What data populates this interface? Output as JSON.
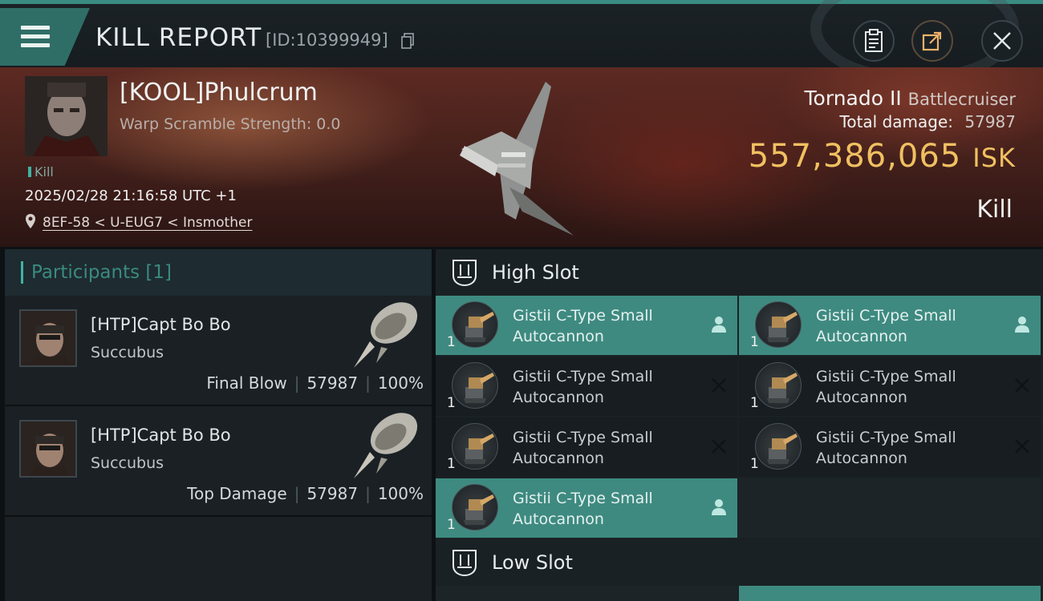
{
  "header": {
    "title": "KILL REPORT",
    "report_id": "[ID:10399949]",
    "icons": [
      "menu-icon",
      "copy-icon",
      "clipboard-icon",
      "share-icon",
      "close-icon"
    ]
  },
  "victim": {
    "name": "[KOOL]Phulcrum",
    "scramble": "Warp Scramble Strength: 0.0",
    "tag": "Kill",
    "timestamp": "2025/02/28 21:16:58 UTC +1",
    "location": "8EF-58 < U-EUG7 < Insmother",
    "ship": "Tornado II",
    "ship_class": "Battlecruiser",
    "total_damage_label": "Total damage:",
    "total_damage": "57987",
    "isk": "557,386,065",
    "isk_unit": "ISK",
    "result": "Kill"
  },
  "participants": {
    "header": "Participants [1]",
    "rows": [
      {
        "name": "[HTP]Capt Bo Bo",
        "ship": "Succubus",
        "role": "Final Blow",
        "damage": "57987",
        "percent": "100%"
      },
      {
        "name": "[HTP]Capt Bo Bo",
        "ship": "Succubus",
        "role": "Top Damage",
        "damage": "57987",
        "percent": "100%"
      }
    ]
  },
  "high_slot": {
    "title": "High Slot",
    "items": [
      {
        "line1": "Gistii C-Type Small",
        "line2": "Autocannon",
        "qty": "1",
        "state": "dropped"
      },
      {
        "line1": "Gistii C-Type Small",
        "line2": "Autocannon",
        "qty": "1",
        "state": "dropped"
      },
      {
        "line1": "Gistii C-Type Small",
        "line2": "Autocannon",
        "qty": "1",
        "state": "destroyed"
      },
      {
        "line1": "Gistii C-Type Small",
        "line2": "Autocannon",
        "qty": "1",
        "state": "destroyed"
      },
      {
        "line1": "Gistii C-Type Small",
        "line2": "Autocannon",
        "qty": "1",
        "state": "destroyed"
      },
      {
        "line1": "Gistii C-Type Small",
        "line2": "Autocannon",
        "qty": "1",
        "state": "destroyed"
      },
      {
        "line1": "Gistii C-Type Small",
        "line2": "Autocannon",
        "qty": "1",
        "state": "dropped"
      }
    ]
  },
  "low_slot": {
    "title": "Low Slot"
  },
  "colors": {
    "accent": "#3e8a80",
    "isk": "#f0c061",
    "teal_text": "#3a8a80"
  }
}
